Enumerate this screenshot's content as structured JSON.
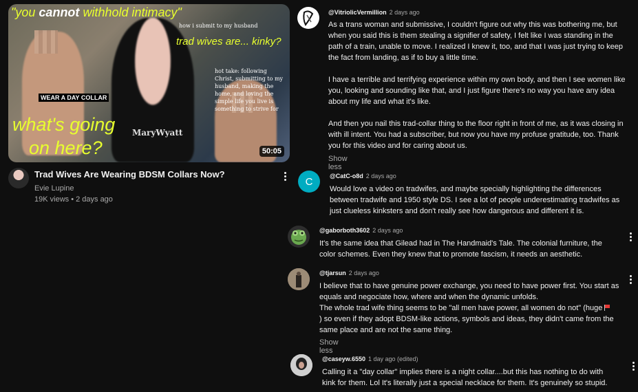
{
  "video": {
    "thumbnail": {
      "caption_top": "\"you cannot withhold intimacy\"",
      "caption_top_a": "\"you ",
      "caption_top_b": "cannot",
      "caption_top_c": " withhold intimacy\"",
      "caption_submit": "how i submit to my husband",
      "caption_tradwives": "trad wives are... kinky?",
      "caption_collar": "WEAR A DAY COLLAR",
      "caption_hottake": "hot take: following Christ, submitting to my husband, making the home, and loving the simple life you live is something to strive for",
      "caption_going1": "what's going",
      "caption_going2": "on here?",
      "shirt_text": "MaryWyatt",
      "duration": "50:05"
    },
    "title": "Trad Wives Are Wearing BDSM Collars Now?",
    "channel": "Evie Lupine",
    "stats": "19K views • 2 days ago"
  },
  "comments": [
    {
      "user": "@VitriolicVermillion",
      "time": "2 days ago",
      "paragraphs": [
        "As a trans woman and submissive, I couldn't figure out why this was bothering me, but when you said this is them stealing a signifier of safety, I felt like I was standing in the path of a train, unable to move. I realized I knew it, too, and that I was just trying to keep the fact from landing, as if to buy a little time.",
        "I have a terrible and terrifying experience within my own body, and then I see women like you, looking and sounding like that, and I just figure there's no way you have any idea about my life and what it's like.",
        "And then you nail this trad-collar thing to the floor right in front of me, as it was closing in with ill intent. You had a subscriber, but now you have my profuse gratitude, too. Thank you for this video and for caring about us."
      ],
      "show_less": "Show less"
    },
    {
      "user": "@CatC-o8d",
      "time": "2 days ago",
      "avatar_letter": "C",
      "avatar_color": "#00acc1",
      "paragraphs": [
        "Would love a video on tradwifes, and maybe specially highlighting the differences between tradwife and 1950 style DS. I see a lot of people underestimating tradwifes as just clueless kinksters and don't really see how dangerous and different it is."
      ]
    },
    {
      "user": "@gaborboth3602",
      "time": "2 days ago",
      "paragraphs": [
        "It's the same idea that Gilead had in The Handmaid's Tale. The colonial furniture, the color schemes. Even they knew that to promote fascism, it needs an aesthetic."
      ]
    },
    {
      "user": "@tjarsun",
      "time": "2 days ago",
      "paragraphs": [
        "I believe that to have genuine power exchange, you need to have power first. You start as equals and negociate how, where and when the dynamic unfolds."
      ],
      "line2_a": "The whole trad wife thing seems to be \"all men have power, all women do not\" (huge",
      "line2_b": ") so even if they adopt BDSM-like actions, symbols and ideas, they didn't came from the same place and are not the same thing.",
      "show_less": "Show less"
    },
    {
      "user": "@caseyw.6550",
      "time": "1 day ago (edited)",
      "paragraphs": [
        "Calling it a \"day collar\" implies there is a night collar....but this has nothing to do with kink for them. Lol It's literally just a special necklace for them. It's genuinely so stupid."
      ]
    }
  ]
}
